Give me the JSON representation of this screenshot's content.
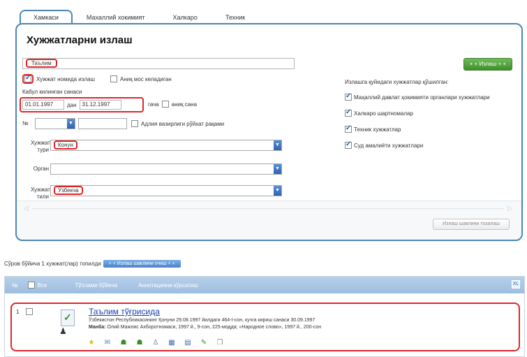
{
  "tabs": [
    {
      "label": "Хамкаси"
    },
    {
      "label": "Махаллий хокимият"
    },
    {
      "label": "Халкаро"
    },
    {
      "label": "Техник"
    }
  ],
  "panel": {
    "title": "Хужжатларни излаш",
    "search_value": "Таълим",
    "search_button": "+ + Излаш + +",
    "check_name_label": "Хужжат номида излаш",
    "check_exact_label": "Аниқ мос келадиган",
    "date_label": "Кабул килинган санаси",
    "date_from": "01.01.1997",
    "date_from_suffix": "дан",
    "date_to": "31.12.1997",
    "date_to_suffix": "гача",
    "exact_date_label": "аниқ сана",
    "num_label": "№",
    "reg_label": "Адлия вазирлиги рўйхат рақами",
    "doc_type_label": "Хужжат тури",
    "doc_type_value": "Конун",
    "organ_label": "Орган",
    "organ_value": "",
    "doc_lang_label": "Хужжат тили",
    "doc_lang_value": "Ўзбекча",
    "reset_button": "Излаш шаклини тозалаш"
  },
  "right": {
    "heading": "Излашга қуйидаги хужжатлар қўшилган:",
    "items": [
      "Маҳаллий давлат ҳокимияти органлари хужжатлари",
      "Халкаро шартномалар",
      "Техник хужжатлар",
      "Суд амалиёти хужжатлари"
    ]
  },
  "found": {
    "text": "Сўров бўйича 1 хужжат(лар) топилди",
    "button": "+ + Излаш шаклини очиш + +"
  },
  "results": {
    "head": {
      "num": "№",
      "all": "Все",
      "title": "Тўплами бўйича",
      "annotation": "Аннотацияни кўрсатиш",
      "export": "XL"
    },
    "rows": [
      {
        "num": "1",
        "title": "Таълим тўғрисида",
        "line1": "Ўзбекистон Республикасининг Қонуни 29.08.1997 йилдаги 464-I-сон, кучга кириш санаси 30.09.1997",
        "source_label": "Манба:",
        "line2": "Олий Мажлис Ахборотномаси, 1997 й., 9-сон, 225-модда; «Народное слово», 1997 й., 200-сон"
      }
    ]
  },
  "colors": {
    "accent": "#4a86b8",
    "highlight": "#e0262b",
    "search_button": "#4f9e3c",
    "link": "#1a3fb0"
  }
}
